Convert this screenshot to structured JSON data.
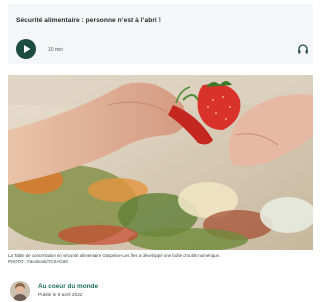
{
  "audio": {
    "title": "Sécurité alimentaire : personne n’est à l’abri !",
    "duration": "10 min",
    "play_icon": "play-icon",
    "headphones_icon": "headphones-icon"
  },
  "photo": {
    "caption_line1": "La Table de concertation en sécurité alimentaire Gaspésie-Les Îles a développé une boîte d’outils numérique.",
    "caption_line2": "PHOTO : Facebook/TCSAGIM"
  },
  "author": {
    "name": "Au coeur du monde",
    "published": "Publié le 8 avril 2022"
  },
  "colors": {
    "accent": "#1c4b3f",
    "author_link": "#1c6e5e",
    "card_bg": "#f4f6f7"
  }
}
